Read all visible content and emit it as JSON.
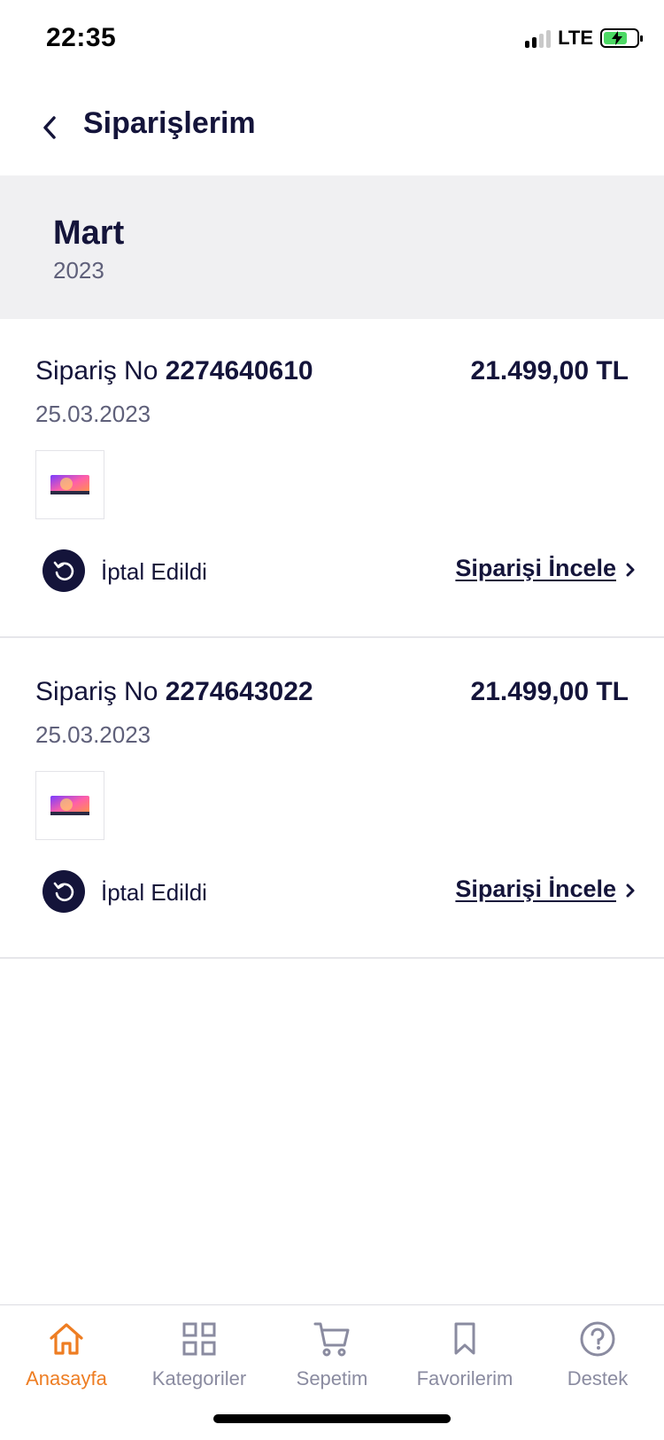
{
  "status_bar": {
    "time": "22:35",
    "network": "LTE"
  },
  "header": {
    "title": "Siparişlerim"
  },
  "month_group": {
    "month": "Mart",
    "year": "2023"
  },
  "orders": [
    {
      "order_no_label": "Sipariş No",
      "order_no": "2274640610",
      "total": "21.499,00 TL",
      "date": "25.03.2023",
      "status": "İptal Edildi",
      "review_label": "Siparişi İncele"
    },
    {
      "order_no_label": "Sipariş No",
      "order_no": "2274643022",
      "total": "21.499,00 TL",
      "date": "25.03.2023",
      "status": "İptal Edildi",
      "review_label": "Siparişi İncele"
    }
  ],
  "tab_bar": {
    "items": [
      {
        "label": "Anasayfa",
        "icon": "home-icon",
        "active": true
      },
      {
        "label": "Kategoriler",
        "icon": "grid-icon",
        "active": false
      },
      {
        "label": "Sepetim",
        "icon": "cart-icon",
        "active": false
      },
      {
        "label": "Favorilerim",
        "icon": "bookmark-icon",
        "active": false
      },
      {
        "label": "Destek",
        "icon": "help-icon",
        "active": false
      }
    ]
  },
  "colors": {
    "primary": "#14143a",
    "accent": "#ee7d22",
    "muted": "#5f607a",
    "section_bg": "#f0f0f2",
    "inactive_tab": "#8a8ba0"
  }
}
